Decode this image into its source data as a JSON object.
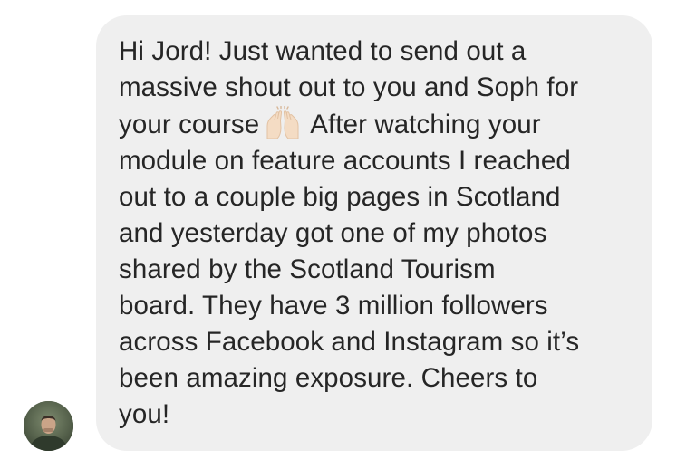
{
  "conversation": {
    "message": {
      "lines": [
        "Hi Jord! Just wanted to send out a",
        "massive shout out to you and Soph for",
        "your course",
        "After watching your",
        "module on feature accounts I reached",
        "out to a couple big pages in Scotland",
        "and yesterday got one of my photos",
        "shared by the Scotland Tourism",
        "board. They have 3 million followers",
        "across Facebook and Instagram so it’s",
        "been amazing exposure. Cheers to",
        "you!"
      ],
      "emoji": "raising-hands-emoji",
      "bubble_color": "#efefef",
      "text_color": "#262626"
    },
    "sender": {
      "avatar_icon": "user-avatar"
    }
  }
}
